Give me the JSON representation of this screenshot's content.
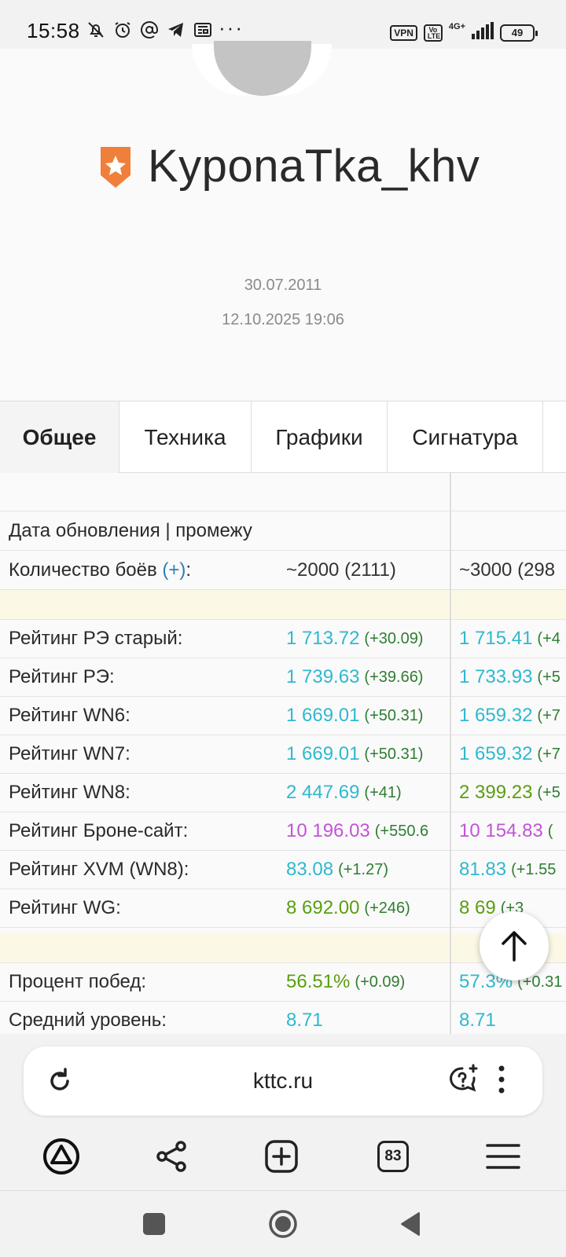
{
  "status_bar": {
    "time": "15:58",
    "overflow": "···",
    "vpn": "VPN",
    "volte": "Vo LTE",
    "network": "4G+",
    "battery": "49",
    "icons": [
      "bell-off-icon",
      "alarm-icon",
      "at-sign-icon",
      "telegram-icon",
      "newspaper-icon"
    ]
  },
  "profile": {
    "username": "KyponaTka_khv",
    "registration_date": "30.07.2011",
    "updated_at": "12.10.2025 19:06",
    "badge_color": "#f07f3c"
  },
  "tabs": [
    {
      "label": "Общее",
      "active": true
    },
    {
      "label": "Техника",
      "active": false
    },
    {
      "label": "Графики",
      "active": false
    },
    {
      "label": "Сигнатура",
      "active": false
    }
  ],
  "table": {
    "update_label": "Дата обновления | промежу",
    "battles": {
      "label": "Количество боёв",
      "plus": "(+)",
      "colon": ":",
      "v1": "~2000 (2111)",
      "v2": "~3000 (298"
    },
    "ratings": [
      {
        "label": "Рейтинг РЭ старый:",
        "v1": "1 713.72",
        "d1": "(+30.09)",
        "v2": "1 715.41",
        "d2": "(+4",
        "c1": "cyan",
        "c2": "cyan"
      },
      {
        "label": "Рейтинг РЭ:",
        "v1": "1 739.63",
        "d1": "(+39.66)",
        "v2": "1 733.93",
        "d2": "(+5",
        "c1": "cyan",
        "c2": "cyan"
      },
      {
        "label": "Рейтинг WN6:",
        "v1": "1 669.01",
        "d1": "(+50.31)",
        "v2": "1 659.32",
        "d2": "(+7",
        "c1": "cyan",
        "c2": "cyan"
      },
      {
        "label": "Рейтинг WN7:",
        "v1": "1 669.01",
        "d1": "(+50.31)",
        "v2": "1 659.32",
        "d2": "(+7",
        "c1": "cyan",
        "c2": "cyan"
      },
      {
        "label": "Рейтинг WN8:",
        "v1": "2 447.69",
        "d1": "(+41)",
        "v2": "2 399.23",
        "d2": "(+5",
        "c1": "cyan",
        "c2": "green"
      },
      {
        "label": "Рейтинг Броне-сайт:",
        "v1": "10 196.03",
        "d1": "(+550.6",
        "v2": "10 154.83",
        "d2": "(",
        "c1": "violet",
        "c2": "violet"
      },
      {
        "label": "Рейтинг XVM (WN8):",
        "v1": "83.08",
        "d1": "(+1.27)",
        "v2": "81.83",
        "d2": "(+1.55",
        "c1": "cyan",
        "c2": "cyan"
      },
      {
        "label": "Рейтинг WG:",
        "v1": "8 692.00",
        "d1": "(+246)",
        "v2": "8 69",
        "d2": "(+3",
        "c1": "green",
        "c2": "green"
      }
    ],
    "stats": [
      {
        "label": "Процент побед:",
        "v1": "56.51%",
        "d1": "(+0.09)",
        "v2": "57.3%",
        "d2": "(+0.31",
        "c1": "green",
        "c2": "cyan"
      },
      {
        "label": "Средний уровень:",
        "v1": "8.71",
        "d1": "",
        "v2": "8.71",
        "d2": "",
        "c1": "cyan",
        "c2": "cyan"
      }
    ]
  },
  "address_bar": {
    "url": "kttc.ru"
  },
  "toolbar": {
    "tabs_count": "83"
  },
  "colors": {
    "cyan": "#2fb8cf",
    "green": "#5a9e10",
    "violet": "#c354d6",
    "delta": "#2e7d32",
    "highlight_row": "#fcf8e6"
  }
}
